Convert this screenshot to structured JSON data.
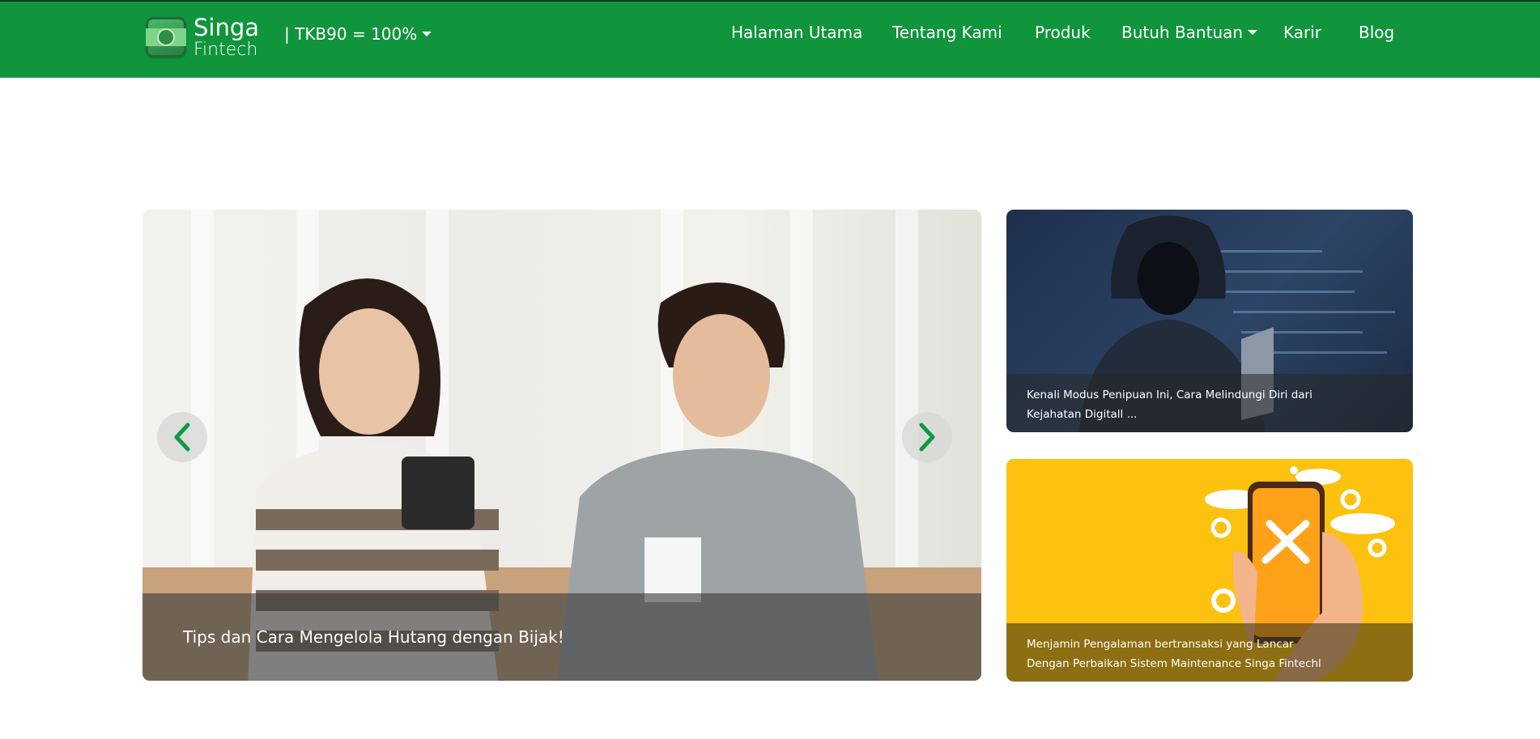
{
  "navbar": {
    "brand": {
      "line1": "Singa",
      "line2": "Fintech"
    },
    "tkb": "| TKB90 = 100%",
    "menu": [
      {
        "label": "Halaman Utama",
        "dropdown": false
      },
      {
        "label": "Tentang Kami",
        "dropdown": false
      },
      {
        "label": "Produk",
        "dropdown": false
      },
      {
        "label": "Butuh Bantuan",
        "dropdown": true
      },
      {
        "label": "Karir",
        "dropdown": false
      },
      {
        "label": "Blog",
        "dropdown": false
      }
    ]
  },
  "hero": {
    "caption": "Tips dan Cara Mengelola Hutang dengan Bijak!"
  },
  "cards": [
    {
      "caption": "Kenali Modus Penipuan Ini, Cara Melindungi Diri dari Kejahatan Digitall ..."
    },
    {
      "caption": "Menjamin Pengalaman bertransaksi yang Lancar Dengan Perbaikan Sistem Maintenance Singa Fintechl ..."
    }
  ],
  "colors": {
    "navbar": "#10953d",
    "arrow": "#0f9a44",
    "card2_bg": "#fdc110"
  }
}
